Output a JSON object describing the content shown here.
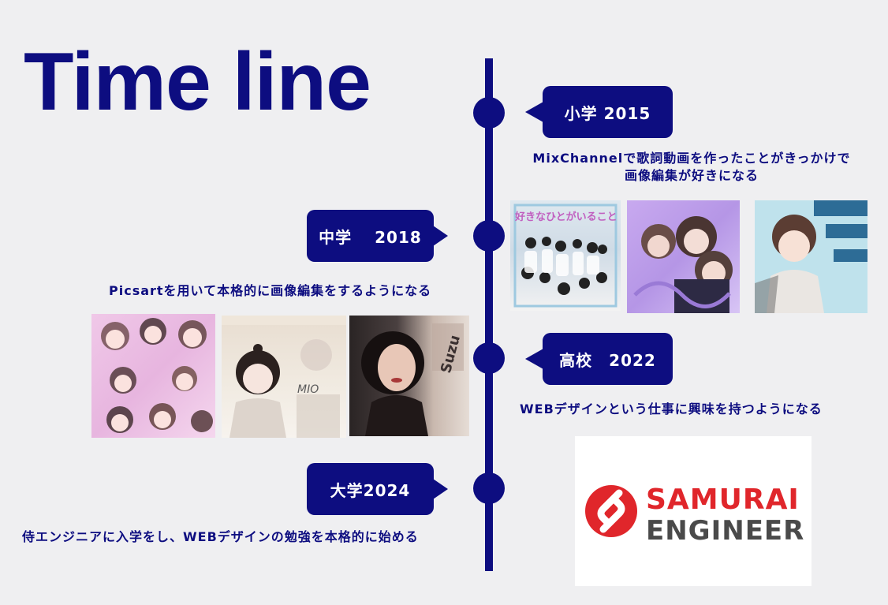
{
  "title": "Time line",
  "timeline": [
    {
      "label": "小学 2015",
      "description": [
        "MixChannelで歌詞動画を作ったことがきっかけで",
        "画像編集が好きになる"
      ]
    },
    {
      "label": "中学　 2018",
      "description": [
        "Picsartを用いて本格的に画像編集をするようになる"
      ]
    },
    {
      "label": "高校　2022",
      "description": [
        "WEBデザインという仕事に興味を持つようになる"
      ]
    },
    {
      "label": "大学2024",
      "description": [
        "侍エンジニアに入学をし、WEBデザインの勉強を本格的に始める"
      ]
    }
  ],
  "images": {
    "mix_thumb_1_text": "好きなひとがいること",
    "picsart_thumb_2_text": "MIO",
    "picsart_thumb_3_text": "Suzu"
  },
  "logo": {
    "line1": "SAMURAI",
    "line2": "ENGINEER"
  },
  "colors": {
    "primary": "#0d0d80",
    "background": "#efeff1",
    "logo_red": "#e0262b",
    "logo_gray": "#4a4a4a"
  }
}
